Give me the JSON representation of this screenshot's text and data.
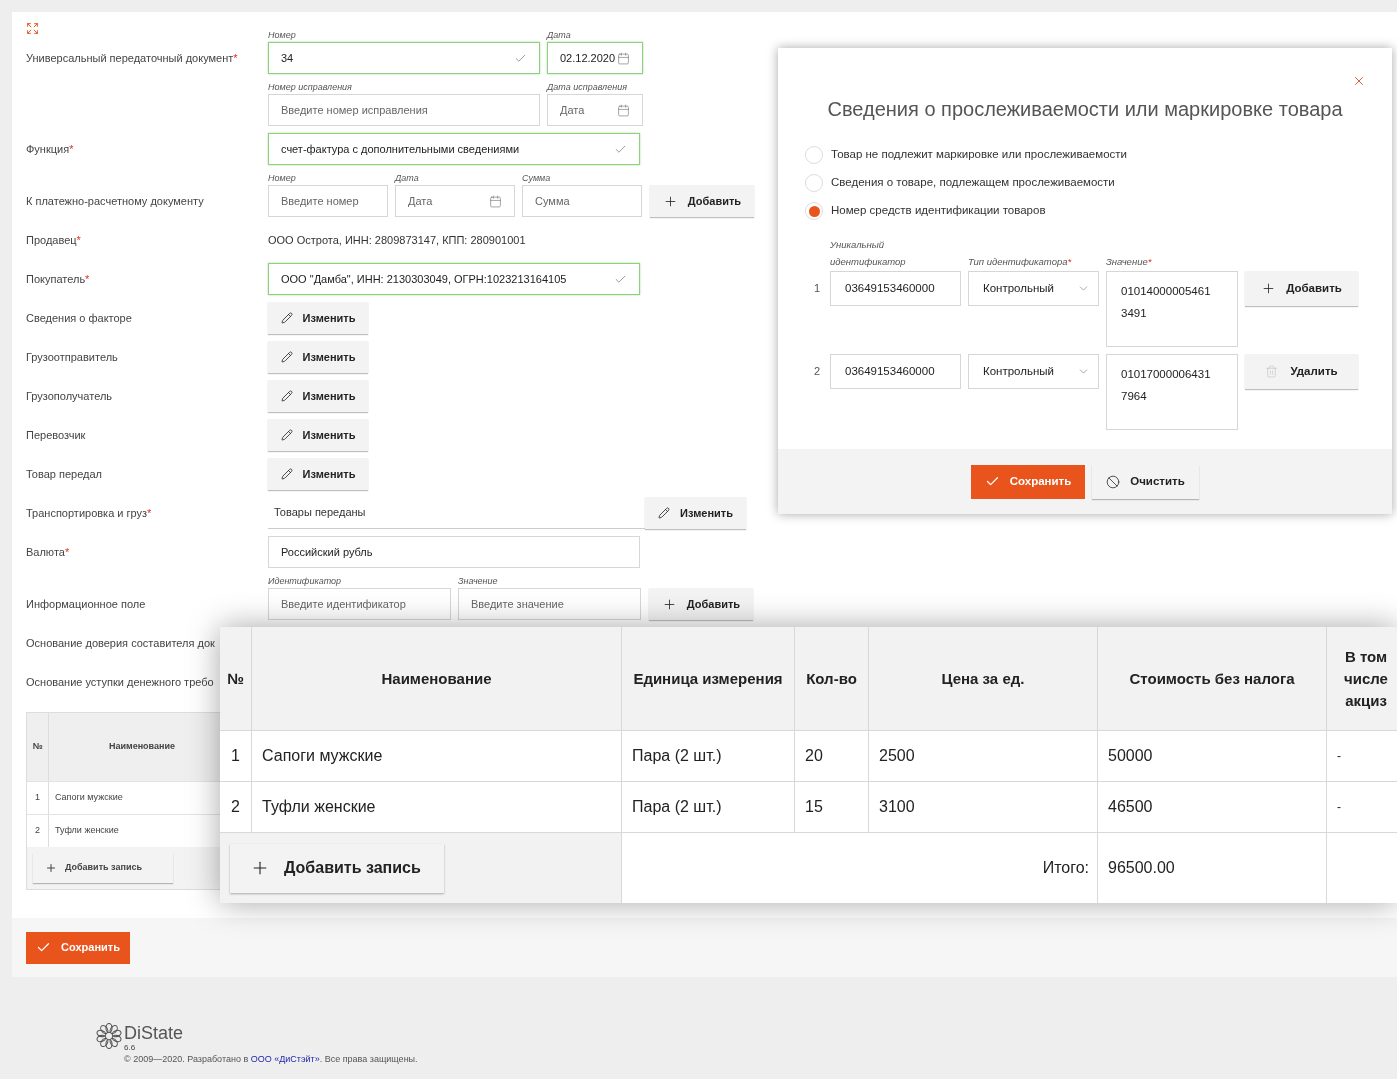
{
  "form": {
    "rows": [
      {
        "kind": "fields",
        "label": "Универсальный передаточный документ",
        "asterisk": "*",
        "fields": [
          {
            "kind": "text",
            "caption": "Номер",
            "value": "34",
            "valid": true
          },
          {
            "kind": "date",
            "caption": "Дата",
            "value": "02.12.2020",
            "valid": true
          }
        ]
      },
      {
        "kind": "fields",
        "fields": [
          {
            "kind": "text",
            "caption": "Номер исправления",
            "placeholder": "Введите номер исправления",
            "valid": false
          },
          {
            "kind": "date",
            "caption": "Дата исправления",
            "placeholder": "Дата",
            "valid": false
          }
        ]
      },
      {
        "kind": "fields",
        "label": "Функция",
        "asterisk": "*",
        "fields": [
          {
            "kind": "text",
            "value": "счет-фактура с дополнительными сведениями",
            "valid": true
          }
        ]
      },
      {
        "kind": "fields",
        "label": "К платежно-расчетному документу",
        "fields": [
          {
            "kind": "text",
            "caption": "Номер",
            "placeholder": "Введите номер",
            "valid": false
          },
          {
            "kind": "date",
            "caption": "Дата",
            "placeholder": "Дата",
            "valid": false
          },
          {
            "kind": "text",
            "caption": "Сумма",
            "placeholder": "Сумма",
            "valid": false
          }
        ],
        "button": "Добавить"
      },
      {
        "kind": "text",
        "label": "Продавец",
        "asterisk": "*",
        "value": "ООО Острота, ИНН: 2809873147, КПП: 280901001"
      },
      {
        "kind": "fields",
        "label": "Покупатель",
        "asterisk": "*",
        "fields": [
          {
            "kind": "text",
            "value": "ООО \"Дамба\", ИНН: 2130303049, ОГРН:1023213164105",
            "valid": true
          }
        ]
      },
      {
        "kind": "edit",
        "label": "Сведения о факторе",
        "button": "Изменить"
      },
      {
        "kind": "edit",
        "label": "Грузоотправитель",
        "button": "Изменить"
      },
      {
        "kind": "edit",
        "label": "Грузополучатель",
        "button": "Изменить"
      },
      {
        "kind": "edit",
        "label": "Перевозчик",
        "button": "Изменить"
      },
      {
        "kind": "edit",
        "label": "Товар передал",
        "button": "Изменить"
      },
      {
        "kind": "summary",
        "label": "Транспортировка и груз",
        "asterisk": "*",
        "value": "Товары переданы",
        "button": "Изменить"
      },
      {
        "kind": "fields",
        "label": "Валюта",
        "asterisk": "*",
        "fields": [
          {
            "kind": "text",
            "value": "Российский рубль",
            "valid": false
          }
        ]
      },
      {
        "kind": "fields",
        "label": "Информационное поле",
        "fields": [
          {
            "kind": "text",
            "caption": "Идентификатор",
            "placeholder": "Введите идентификатор",
            "valid": false
          },
          {
            "kind": "text",
            "caption": "Значение",
            "placeholder": "Введите значение",
            "valid": false
          }
        ],
        "button": "Добавить"
      },
      {
        "kind": "label",
        "label": "Основание доверия составителя док"
      },
      {
        "kind": "label",
        "label": "Основание уступки денежного требо"
      }
    ]
  },
  "background_table": {
    "columns": [
      "№",
      "Наименование"
    ],
    "rows": [
      [
        "1",
        "Сапоги мужские"
      ],
      [
        "2",
        "Туфли женские"
      ]
    ],
    "add_button": "Добавить запись"
  },
  "save_button": "Сохранить",
  "goods_table": {
    "columns": [
      "№",
      "Наименование",
      "Единица измерения",
      "Кол-во",
      "Цена за ед.",
      "Стоимость без налога",
      "В том числе акциз"
    ],
    "rows": [
      [
        "1",
        "Сапоги мужские",
        "Пара (2 шт.)",
        "20",
        "2500",
        "50000",
        "-"
      ],
      [
        "2",
        "Туфли женские",
        "Пара (2 шт.)",
        "15",
        "3100",
        "46500",
        "-"
      ]
    ],
    "add_button": "Добавить запись",
    "total_label": "Итого:",
    "total": "96500.00"
  },
  "modal": {
    "title": "Сведения о прослеживаемости или маркировке товара",
    "options": [
      {
        "label": "Товар не подлежит маркировке или прослеживаемости",
        "selected": false
      },
      {
        "label": "Сведения о товаре, подлежащем прослеживаемости",
        "selected": false
      },
      {
        "label": "Номер средств идентификации товаров",
        "selected": true
      }
    ],
    "columns": [
      {
        "caption": "Уникальный идентификатор"
      },
      {
        "caption": "Тип идентификатора",
        "asterisk": "*"
      },
      {
        "caption": "Значение",
        "asterisk": "*"
      }
    ],
    "rows": [
      {
        "index": "1",
        "uid": "03649153460000",
        "type": "Контрольный",
        "value": "010140000054613491",
        "action": {
          "kind": "add",
          "label": "Добавить"
        }
      },
      {
        "index": "2",
        "uid": "03649153460000",
        "type": "Контрольный",
        "value": "010170000064317964",
        "action": {
          "kind": "delete",
          "label": "Удалить"
        }
      }
    ],
    "save_button": "Сохранить",
    "clear_button": "Очистить"
  },
  "footer": {
    "brand": "DiState",
    "version": "6.6",
    "copyright_before": "© 2009—2020. Разработано в ",
    "link": "ООО «ДиСтэйт»",
    "copyright_after": ". Все права защищены."
  }
}
